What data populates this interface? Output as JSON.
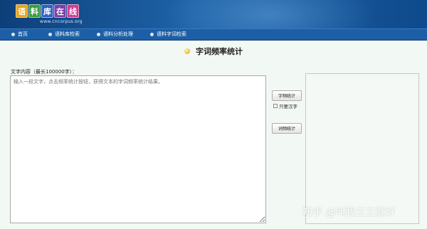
{
  "header": {
    "logo_chars": [
      "语",
      "料",
      "库",
      "在",
      "线"
    ],
    "logo_colors": [
      "#e8a21c",
      "#3a9c3a",
      "#2d5fc4",
      "#7a3ea8",
      "#d13c8f"
    ],
    "logo_subtitle": "www.cncorpus.org"
  },
  "nav": {
    "items": [
      {
        "label": "首页"
      },
      {
        "label": "语料库检索"
      },
      {
        "label": "语料分析处理"
      },
      {
        "label": "语料字词检索"
      }
    ]
  },
  "page": {
    "title": "字词频率统计"
  },
  "form": {
    "textarea_label": "文字内容（最长100000字）：",
    "textarea_placeholder": "输入一段文字，点击频率统计按钮，获得文本的字词频率统计结果。",
    "char_freq_button": "字频统计",
    "only_chinese_label": "只要汉字",
    "word_freq_button": "词频统计"
  },
  "watermark": "知乎 @叫我三三就好"
}
